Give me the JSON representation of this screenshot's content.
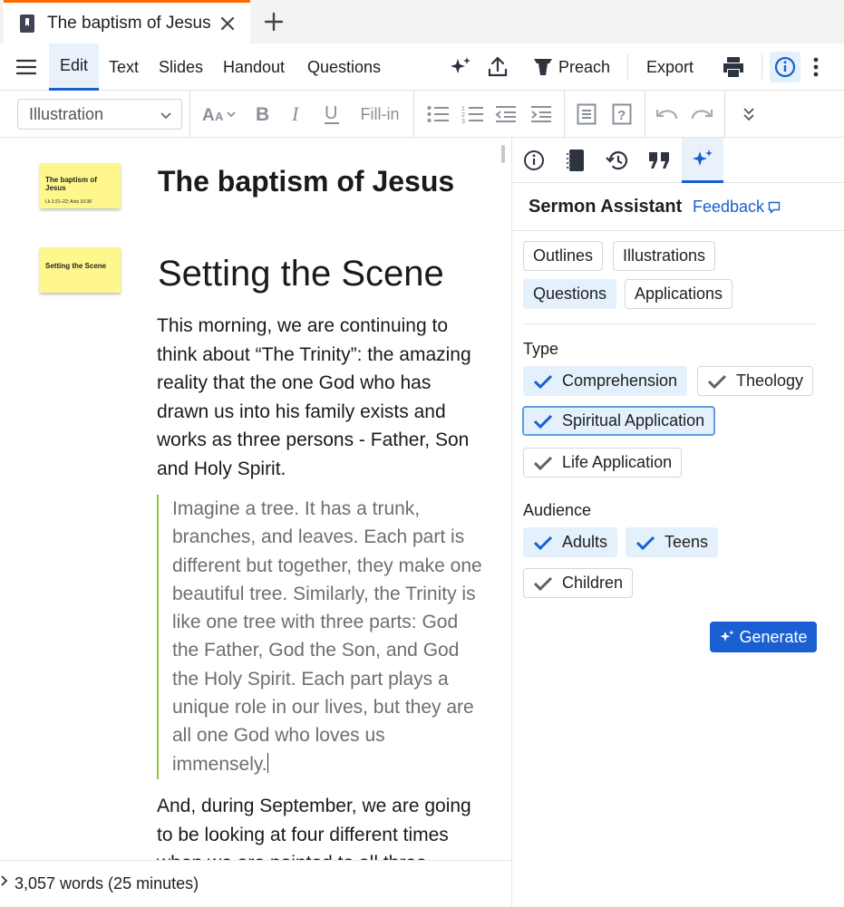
{
  "tab": {
    "title": "The baptism of Jesus"
  },
  "menu": {
    "tabs": [
      "Edit",
      "Text",
      "Slides",
      "Handout",
      "Questions"
    ],
    "preach_label": "Preach",
    "export_label": "Export"
  },
  "format": {
    "style_value": "Illustration",
    "fillin_label": "Fill-in"
  },
  "editor": {
    "sticky1_title": "The baptism of Jesus",
    "sticky1_ref": "Lk 3:21–22; Acts 10:38",
    "sticky2_title": "Setting the Scene",
    "doc_title": "The baptism of Jesus",
    "heading": "Setting the Scene",
    "para1": "This morning, we are continuing to think about “The Trinity”: the amazing reality that the one God who has drawn us into his family exists and works as three persons - Father, Son and Holy Spirit.",
    "quote": "Imagine a tree. It has a trunk, branches, and leaves. Each part is different but together, they make one beautiful tree. Similarly, the Trinity is like one tree with three parts: God the Father, God the Son, and God the Holy Spirit. Each part plays a unique role in our lives, but they are all one God who loves us immensely.",
    "para2": "And, during September, we are going to be looking at four different times when we are pointed to all three persons"
  },
  "footer": {
    "word_count": "3,057 words (25 minutes)"
  },
  "panel": {
    "title": "Sermon Assistant",
    "feedback": "Feedback",
    "modes": [
      {
        "label": "Outlines",
        "selected": false
      },
      {
        "label": "Illustrations",
        "selected": false
      },
      {
        "label": "Questions",
        "selected": true
      },
      {
        "label": "Applications",
        "selected": false
      }
    ],
    "type_label": "Type",
    "types": [
      {
        "label": "Comprehension",
        "selected": true
      },
      {
        "label": "Theology",
        "selected": false
      },
      {
        "label": "Spiritual Application",
        "selected": true
      },
      {
        "label": "Life Application",
        "selected": false
      }
    ],
    "audience_label": "Audience",
    "audiences": [
      {
        "label": "Adults",
        "selected": true
      },
      {
        "label": "Teens",
        "selected": true
      },
      {
        "label": "Children",
        "selected": false
      }
    ],
    "generate_label": "Generate"
  },
  "colors": {
    "accent": "#1a5fd1",
    "tab_accent": "#ff6a00",
    "chip_selected": "#e4f0fb",
    "quote_bar": "#8fbf3b",
    "sticky": "#fff68c"
  }
}
